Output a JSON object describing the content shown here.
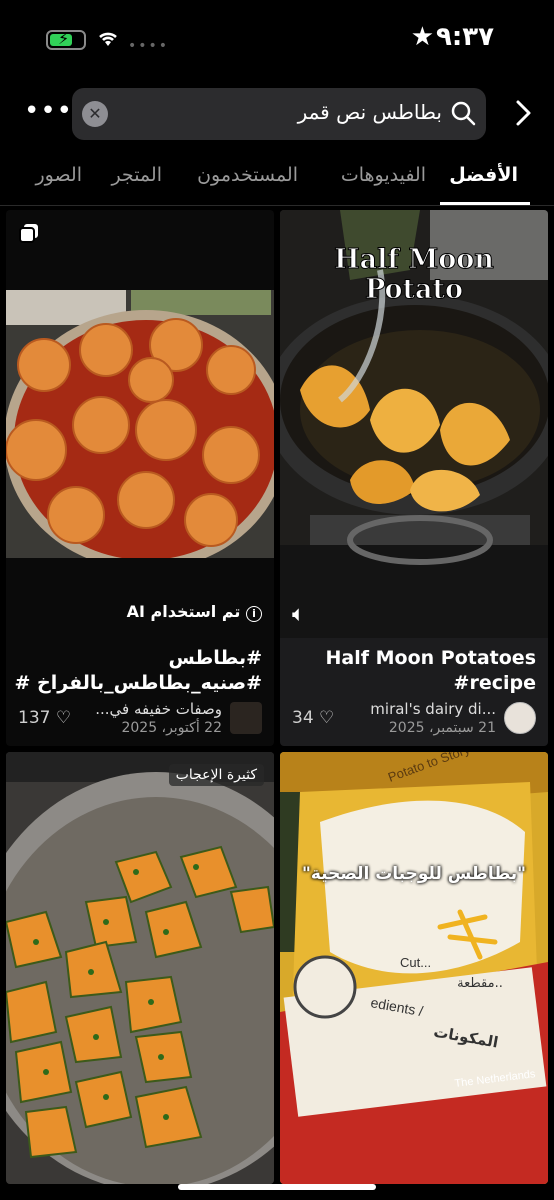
{
  "status": {
    "time": "٩:٣٧"
  },
  "search": {
    "query": "بطاطس نص قمر"
  },
  "tabs": [
    {
      "label": "الأفضل"
    },
    {
      "label": "الفيديوهات"
    },
    {
      "label": "المستخدمون"
    },
    {
      "label": "المتجر"
    },
    {
      "label": "الصور"
    }
  ],
  "cards": [
    {
      "overlay_title_1": "Half Moon",
      "overlay_title_2": "Potato",
      "title_line1": "Half Moon Potatoes",
      "title_line2": "#recipe",
      "author": "miral's dairy di...",
      "date": "21 سبتمبر، 2025",
      "likes": "34"
    },
    {
      "ai_label": "تم استخدام AI",
      "title_line1": "#بطاطس",
      "title_line2": "#صنيه_بطاطس_بالفراخ #ا...",
      "author": "وصفات خفيفه في...",
      "date": "22 أكتوبر، 2025",
      "likes": "137"
    },
    {
      "caption": "\"بطاطس للوجبات الصحية\"",
      "package_brand": "Potato to Story",
      "package_cut": "Cut...",
      "package_cut_ar": "مقطعة..",
      "package_ingredients_ar": "المكونات",
      "package_ingredients_en": "edients /",
      "package_country": "The Netherlands"
    },
    {
      "badge": "كثيرة الإعجاب"
    }
  ],
  "colors": {
    "background": "#000000",
    "card": "#1c1c1e",
    "search_box": "#2c2c2e",
    "battery": "#31d158"
  }
}
